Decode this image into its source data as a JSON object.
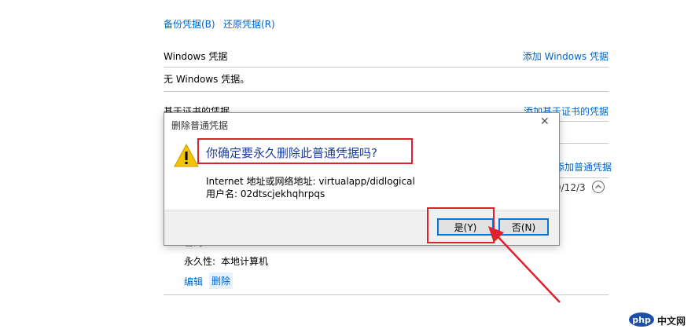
{
  "top_links": {
    "backup": "备份凭据(B)",
    "restore": "还原凭据(R)"
  },
  "windows_section": {
    "title": "Windows 凭据",
    "add_link": "添加 Windows 凭据",
    "empty_text": "无 Windows 凭据。"
  },
  "cert_section": {
    "title": "基于证书的凭据",
    "add_link": "添加基于证书的凭据"
  },
  "generic_section": {
    "add_link": "添加普通凭据",
    "date_fragment": "9/12/3"
  },
  "credential_details": {
    "password_label": "密码:",
    "password_value": "••••••••",
    "persistence_label": "永久性:",
    "persistence_value": "本地计算机",
    "edit": "编辑",
    "delete": "删除"
  },
  "dialog": {
    "title": "删除普通凭据",
    "close_glyph": "✕",
    "question": "你确定要永久删除此普通凭据吗?",
    "address_line": "Internet 地址或网络地址: virtualapp/didlogical",
    "user_line": "用户名: 02dtscjekhqhrpqs",
    "yes": "是(Y)",
    "no": "否(N)"
  },
  "watermark": {
    "logo": "php",
    "site": "中文网"
  },
  "colors": {
    "link": "#0066cc",
    "highlight": "#e0202a",
    "button_border": "#0078d7",
    "warning": "#f5c400"
  },
  "icons": {
    "warning": "warning-icon",
    "close": "close-icon",
    "collapse": "chevron-up-icon"
  }
}
